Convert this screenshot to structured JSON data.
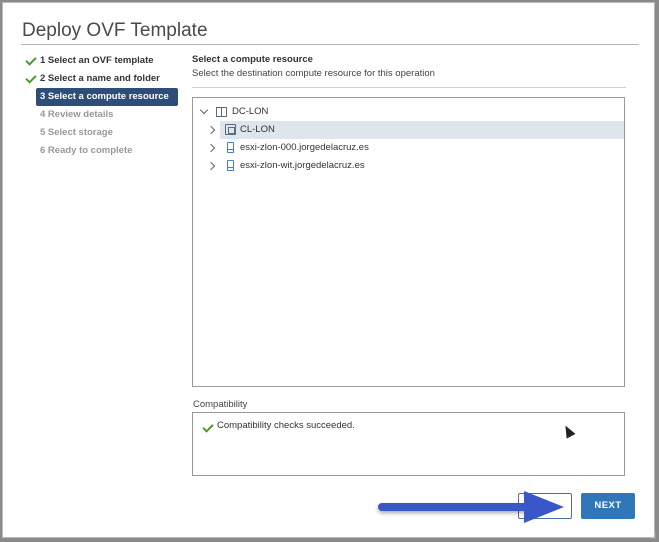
{
  "dialog": {
    "title": "Deploy OVF Template"
  },
  "steps": [
    {
      "label": "1 Select an OVF template",
      "state": "done"
    },
    {
      "label": "2 Select a name and folder",
      "state": "done"
    },
    {
      "label": "3 Select a compute resource",
      "state": "active"
    },
    {
      "label": "4 Review details",
      "state": "pending"
    },
    {
      "label": "5 Select storage",
      "state": "pending"
    },
    {
      "label": "6 Ready to complete",
      "state": "pending"
    }
  ],
  "main": {
    "heading": "Select a compute resource",
    "subheading": "Select the destination compute resource for this operation"
  },
  "tree": {
    "datacenter": "DC-LON",
    "children": [
      {
        "label": "CL-LON",
        "icon": "cluster-icon",
        "selected": true
      },
      {
        "label": "esxi-zlon-000.jorgedelacruz.es",
        "icon": "host-icon",
        "selected": false
      },
      {
        "label": "esxi-zlon-wit.jorgedelacruz.es",
        "icon": "host-icon",
        "selected": false
      }
    ]
  },
  "compatibility": {
    "label": "Compatibility",
    "message": "Compatibility checks succeeded."
  },
  "buttons": {
    "next": "NEXT"
  },
  "colors": {
    "accent": "#2f77b9",
    "active_step": "#2d4e78",
    "success": "#4c9b2c",
    "arrow": "#3a57c8"
  }
}
